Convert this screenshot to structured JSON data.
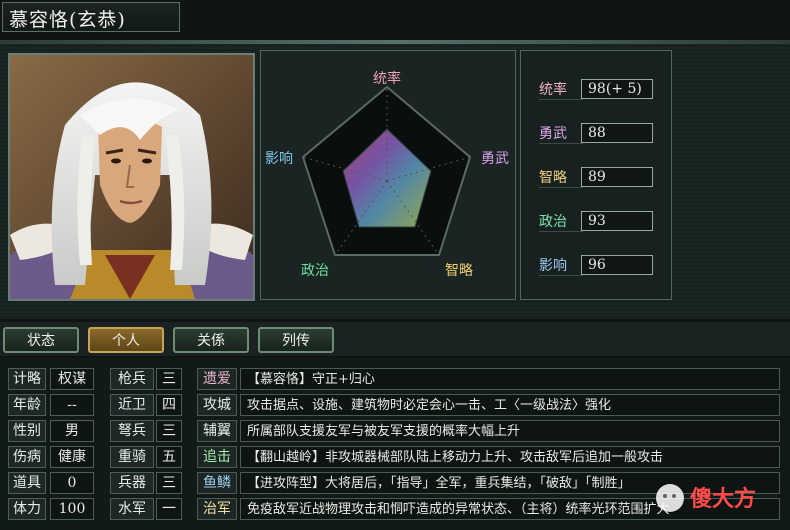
{
  "header": {
    "title": "慕容恪(玄恭)"
  },
  "radar": {
    "axes": [
      "统率",
      "勇武",
      "智略",
      "政治",
      "影响"
    ],
    "axis_colors": [
      "#f0a0b8",
      "#d8a0f0",
      "#f0d070",
      "#70e0a0",
      "#80c8f0"
    ]
  },
  "stats": [
    {
      "label": "统率",
      "value": "98(+ 5)",
      "label_color": "#f3b0c8"
    },
    {
      "label": "勇武",
      "value": "88",
      "label_color": "#e4a8f0"
    },
    {
      "label": "智略",
      "value": "89",
      "label_color": "#f0d080"
    },
    {
      "label": "政治",
      "value": "93",
      "label_color": "#80e0a8"
    },
    {
      "label": "影响",
      "value": "96",
      "label_color": "#a0c8f0"
    }
  ],
  "tabs": [
    {
      "label": "状态"
    },
    {
      "label": "个人"
    },
    {
      "label": "关係"
    },
    {
      "label": "列传"
    }
  ],
  "attributes": [
    {
      "label": "计略",
      "value": "权谋"
    },
    {
      "label": "年龄",
      "value": "--"
    },
    {
      "label": "性别",
      "value": "男"
    },
    {
      "label": "伤病",
      "value": "健康"
    },
    {
      "label": "道具",
      "value": "0"
    },
    {
      "label": "体力",
      "value": "100"
    }
  ],
  "troops": [
    {
      "label": "枪兵",
      "value": "三"
    },
    {
      "label": "近卫",
      "value": "四"
    },
    {
      "label": "弩兵",
      "value": "三"
    },
    {
      "label": "重骑",
      "value": "五"
    },
    {
      "label": "兵器",
      "value": "三"
    },
    {
      "label": "水军",
      "value": "一"
    }
  ],
  "skills": [
    {
      "tag": "遗爱",
      "tag_color": "#f0b8d0",
      "desc": "【慕容恪】守正+归心"
    },
    {
      "tag": "攻城",
      "tag_color": "#e8ece6",
      "desc": "攻击据点、设施、建筑物时必定会心一击、工〈一级战法〉强化"
    },
    {
      "tag": "辅翼",
      "tag_color": "#e8ece6",
      "desc": "所属部队支援友军与被友军支援的概率大幅上升"
    },
    {
      "tag": "追击",
      "tag_color": "#a8f0b0",
      "desc": "【翻山越岭】非攻城器械部队陆上移动力上升、攻击敌军后追加一般攻击"
    },
    {
      "tag": "鱼鳞",
      "tag_color": "#a0d0f0",
      "desc": "【进攻阵型】大将居后，「指导」全军，重兵集结，「破敌」「制胜」"
    },
    {
      "tag": "治军",
      "tag_color": "#f0e0a0",
      "desc": "免疫敌军近战物理攻击和恫吓造成的异常状态、（主将）统率光环范围扩大"
    }
  ],
  "watermark": {
    "text": "傻大方"
  }
}
